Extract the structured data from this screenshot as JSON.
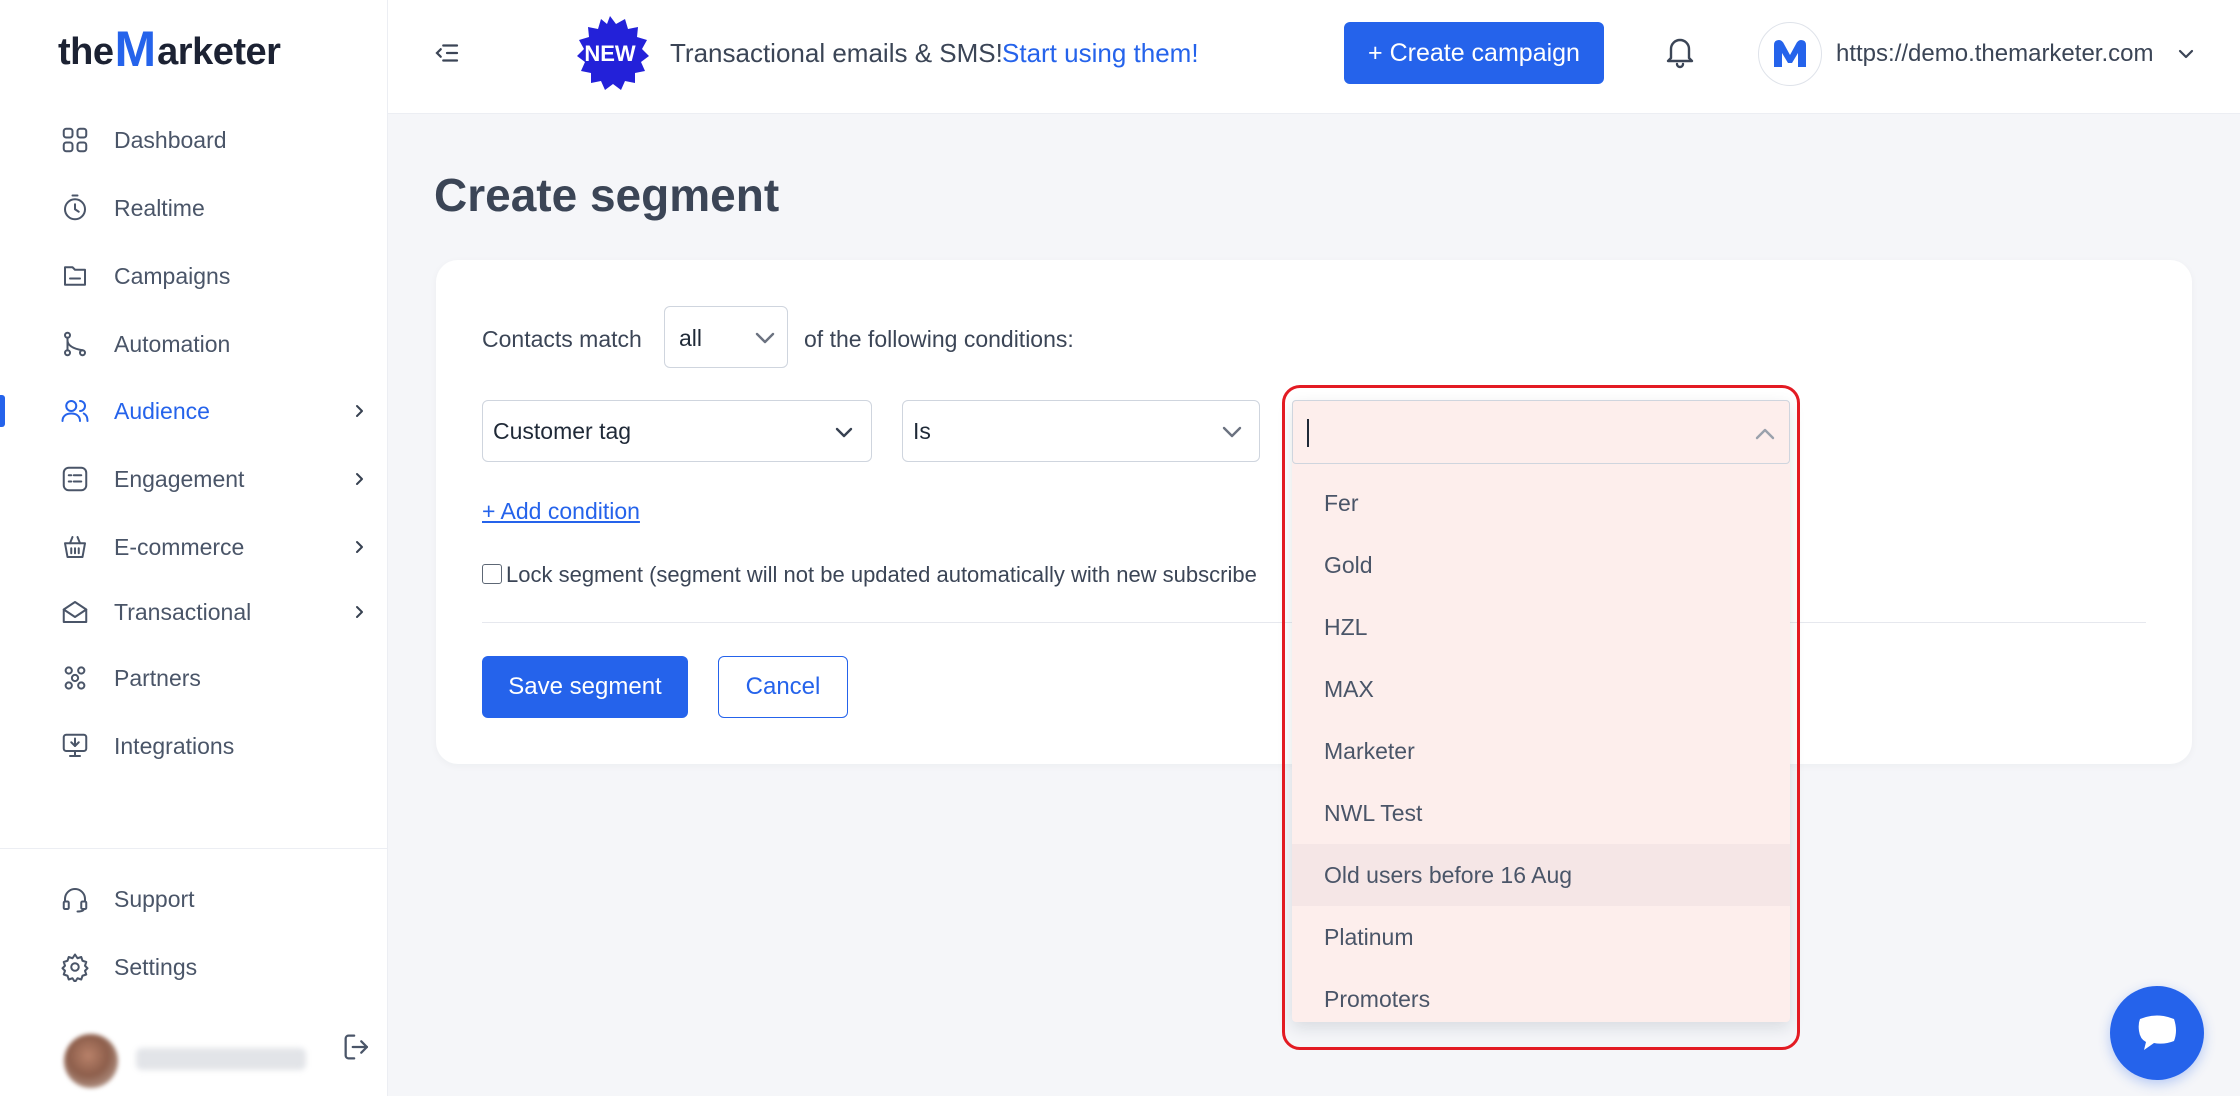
{
  "brand": {
    "logo_part1": "the",
    "logo_m": "M",
    "logo_part2": "arketer",
    "accent": "#2563eb",
    "highlight": "#e31b23"
  },
  "sidebar": {
    "items": [
      {
        "label": "Dashboard",
        "icon": "grid-icon",
        "has_submenu": false,
        "active": false
      },
      {
        "label": "Realtime",
        "icon": "stopwatch-icon",
        "has_submenu": false,
        "active": false
      },
      {
        "label": "Campaigns",
        "icon": "folder-icon",
        "has_submenu": false,
        "active": false
      },
      {
        "label": "Automation",
        "icon": "flow-icon",
        "has_submenu": false,
        "active": false
      },
      {
        "label": "Audience",
        "icon": "users-icon",
        "has_submenu": true,
        "active": true
      },
      {
        "label": "Engagement",
        "icon": "chat-list-icon",
        "has_submenu": true,
        "active": false
      },
      {
        "label": "E-commerce",
        "icon": "basket-icon",
        "has_submenu": true,
        "active": false
      },
      {
        "label": "Transactional",
        "icon": "envelope-open-icon",
        "has_submenu": true,
        "active": false
      },
      {
        "label": "Partners",
        "icon": "partners-icon",
        "has_submenu": false,
        "active": false
      },
      {
        "label": "Integrations",
        "icon": "monitor-download-icon",
        "has_submenu": false,
        "active": false
      }
    ],
    "bottom_items": [
      {
        "label": "Support",
        "icon": "headset-icon"
      },
      {
        "label": "Settings",
        "icon": "gear-icon"
      }
    ]
  },
  "header": {
    "badge": "NEW",
    "promo_text": "Transactional emails & SMS!",
    "promo_link": "Start using them!",
    "create_campaign": "+ Create campaign",
    "account_url": "https://demo.themarketer.com"
  },
  "page": {
    "title": "Create segment",
    "match_label": "Contacts match",
    "match_value": "all",
    "following_label": "of the following conditions:",
    "condition": {
      "field": "Customer tag",
      "operator": "Is",
      "value": ""
    },
    "add_condition": "+ Add condition",
    "lock_label": "Lock segment (segment will not be updated automatically with new subscribe",
    "lock_checked": false,
    "save": "Save segment",
    "cancel": "Cancel"
  },
  "dropdown": {
    "options": [
      "Fer",
      "Gold",
      "HZL",
      "MAX",
      "Marketer",
      "NWL Test",
      "Old users before 16 Aug",
      "Platinum",
      "Promoters"
    ],
    "hovered": "Old users before 16 Aug"
  }
}
